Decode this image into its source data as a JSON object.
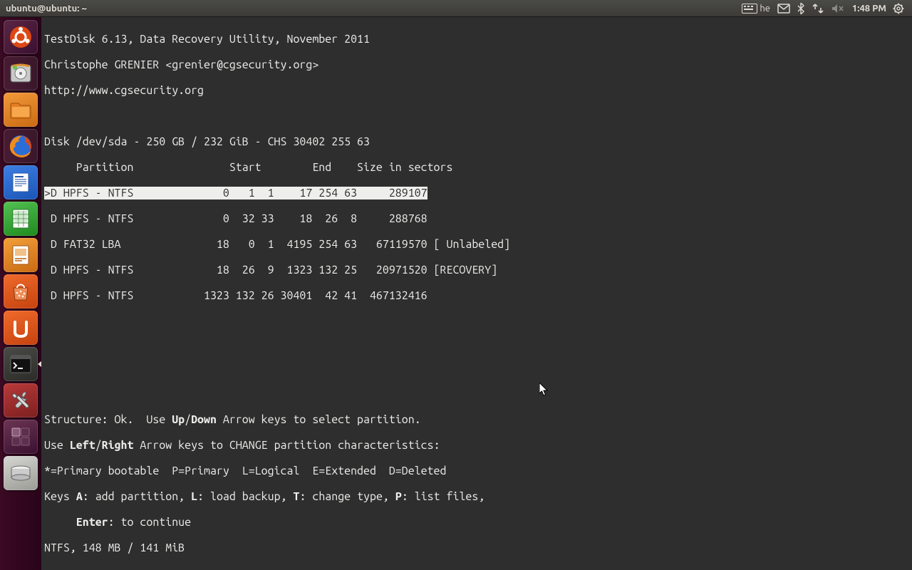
{
  "panel": {
    "title": "ubuntu@ubuntu: ~",
    "keyboard_layout": "he",
    "clock": "1:48 PM"
  },
  "launcher": [
    {
      "name": "dash"
    },
    {
      "name": "disk-utility"
    },
    {
      "name": "files"
    },
    {
      "name": "firefox"
    },
    {
      "name": "writer"
    },
    {
      "name": "calc"
    },
    {
      "name": "impress"
    },
    {
      "name": "software-center"
    },
    {
      "name": "ubuntu-one"
    },
    {
      "name": "terminal",
      "running": true
    },
    {
      "name": "settings"
    },
    {
      "name": "workspace-switcher"
    },
    {
      "name": "removable-drive"
    }
  ],
  "testdisk": {
    "header": [
      "TestDisk 6.13, Data Recovery Utility, November 2011",
      "Christophe GRENIER <grenier@cgsecurity.org>",
      "http://www.cgsecurity.org"
    ],
    "disk_line": "Disk /dev/sda - 250 GB / 232 GiB - CHS 30402 255 63",
    "columns": "     Partition               Start        End    Size in sectors",
    "rows": [
      {
        "sel": true,
        "text": ">D HPFS - NTFS              0   1  1    17 254 63     289107"
      },
      {
        "sel": false,
        "text": " D HPFS - NTFS              0  32 33    18  26  8     288768"
      },
      {
        "sel": false,
        "text": " D FAT32 LBA               18   0  1  4195 254 63   67119570 [ Unlabeled]"
      },
      {
        "sel": false,
        "text": " D HPFS - NTFS             18  26  9  1323 132 25   20971520 [RECOVERY]"
      },
      {
        "sel": false,
        "text": " D HPFS - NTFS           1323 132 26 30401  42 41  467132416"
      }
    ],
    "footer": {
      "f1a": "Structure: Ok.  Use ",
      "f1b": "Up",
      "f1c": "/",
      "f1d": "Down",
      "f1e": " Arrow keys to select partition.",
      "f2a": "Use ",
      "f2b": "Left",
      "f2c": "/",
      "f2d": "Right",
      "f2e": " Arrow keys to CHANGE partition characteristics:",
      "f3": "*=Primary bootable  P=Primary  L=Logical  E=Extended  D=Deleted",
      "f4a": "Keys ",
      "f4b": "A",
      "f4c": ": add partition, ",
      "f4d": "L",
      "f4e": ": load backup, ",
      "f4f": "T",
      "f4g": ": change type, ",
      "f4h": "P",
      "f4i": ": list files,",
      "f5a": "     ",
      "f5b": "Enter",
      "f5c": ": to continue",
      "f6": "NTFS, 148 MB / 141 MiB"
    }
  }
}
